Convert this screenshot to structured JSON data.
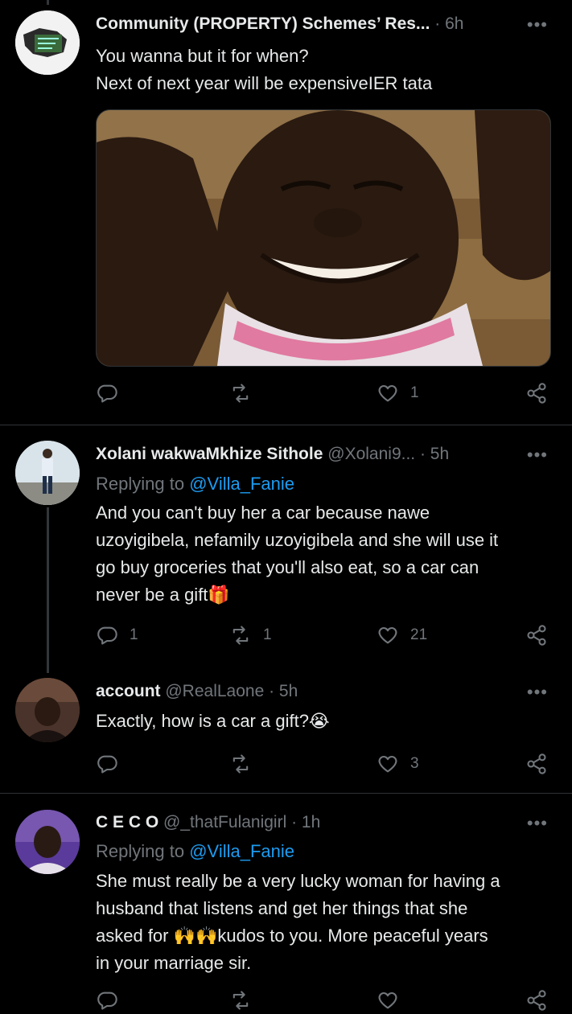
{
  "tweets": [
    {
      "name": "Community (PROPERTY) Schemes’ Res...",
      "handle": "",
      "time": "· 6h",
      "text_lines": [
        "You wanna but it for when?",
        "Next of next year will be expensiveIER tata"
      ],
      "replies": "",
      "retweets": "",
      "likes": "1"
    },
    {
      "name": "Xolani wakwaMkhize Sithole",
      "handle": "@Xolani9...",
      "time": "· 5h",
      "replying_label": "Replying to",
      "replying_to": "@Villa_Fanie",
      "text_lines": [
        "And you can't buy her a car because nawe",
        "uzoyigibela, nefamily uzoyigibela and she will use it",
        "go buy groceries that you'll also eat, so a car can",
        "never be a gift🎁"
      ],
      "replies": "1",
      "retweets": "1",
      "likes": "21"
    },
    {
      "name": "account",
      "handle": "@RealLaone",
      "time": "· 5h",
      "text_lines": [
        "Exactly, how is a car a gift?😭"
      ],
      "replies": "",
      "retweets": "",
      "likes": "3"
    },
    {
      "name": "C E C O",
      "handle": "@_thatFulanigirl",
      "time": "· 1h",
      "replying_label": "Replying to",
      "replying_to": "@Villa_Fanie",
      "text_lines": [
        "She must really be a very lucky woman for  having a",
        "husband that listens and get her things that she",
        "asked for 🙌🙌kudos to you. More peaceful years",
        "in your marriage sir."
      ]
    }
  ],
  "more_glyph": "•••",
  "colors": {
    "background": "#000000",
    "text": "#e7e9ea",
    "muted": "#71767b",
    "link": "#1d9bf0",
    "divider": "#2f3336"
  }
}
